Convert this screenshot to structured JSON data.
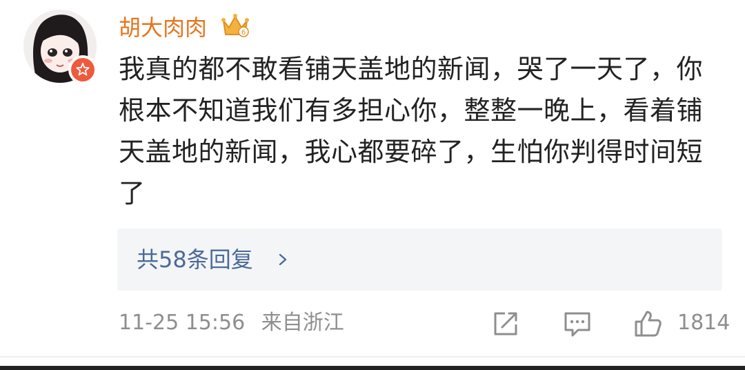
{
  "post": {
    "username": "胡大肉肉",
    "comment": "我真的都不敢看铺天盖地的新闻，哭了一天了，你根本不知道我们有多担心你，整整一晚上，看着铺天盖地的新闻，我心都要碎了，生怕你判得时间短了",
    "replies_label": "共58条回复",
    "timestamp": "11-25 15:56",
    "location": "来自浙江",
    "like_count": "1814"
  },
  "icons": {
    "avatar": "cartoon-girl-avatar",
    "verified": "verified-badge-icon",
    "vip": "crown-vip-icon",
    "chevron": "chevron-right-icon",
    "share": "share-icon",
    "comment": "comment-icon",
    "like": "thumbs-up-icon"
  },
  "colors": {
    "username": "#e6761e",
    "reply_link": "#4a6a9a",
    "meta": "#8e8e8e",
    "badge": "#ef5a3c"
  }
}
